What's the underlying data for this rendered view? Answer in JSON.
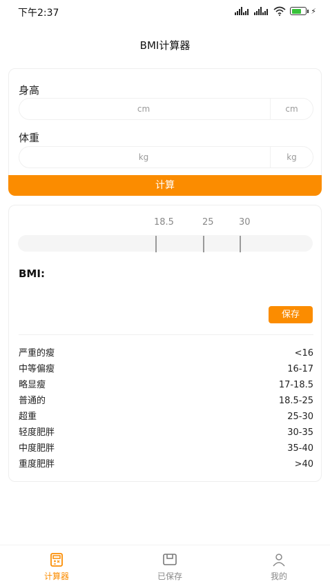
{
  "status_bar": {
    "time": "下午2:37",
    "signal_icon": "signal-icon",
    "wifi_icon": "wifi-icon",
    "battery_icon": "battery-icon",
    "battery_level": 0.7
  },
  "page_title": "BMI计算器",
  "height_field": {
    "label": "身高",
    "placeholder": "cm",
    "unit": "cm",
    "value": ""
  },
  "weight_field": {
    "label": "体重",
    "placeholder": "kg",
    "unit": "kg",
    "value": ""
  },
  "calculate_label": "计算",
  "scale": {
    "labels": [
      "18.5",
      "25",
      "30"
    ]
  },
  "result": {
    "bmi_label": "BMI:",
    "bmi_value": ""
  },
  "save_label": "保存",
  "ranges": [
    {
      "name": "严重的瘦",
      "range": "<16"
    },
    {
      "name": "中等偏瘦",
      "range": "16-17"
    },
    {
      "name": "略显瘦",
      "range": "17-18.5"
    },
    {
      "name": "普通的",
      "range": "18.5-25"
    },
    {
      "name": "超重",
      "range": "25-30"
    },
    {
      "name": "轻度肥胖",
      "range": "30-35"
    },
    {
      "name": "中度肥胖",
      "range": "35-40"
    },
    {
      "name": "重度肥胖",
      "range": ">40"
    }
  ],
  "tabs": [
    {
      "label": "计算器",
      "icon": "calculator-icon",
      "active": true
    },
    {
      "label": "已保存",
      "icon": "saved-icon",
      "active": false
    },
    {
      "label": "我的",
      "icon": "person-icon",
      "active": false
    }
  ],
  "colors": {
    "accent": "#fb8c00",
    "inactive": "#888888"
  }
}
